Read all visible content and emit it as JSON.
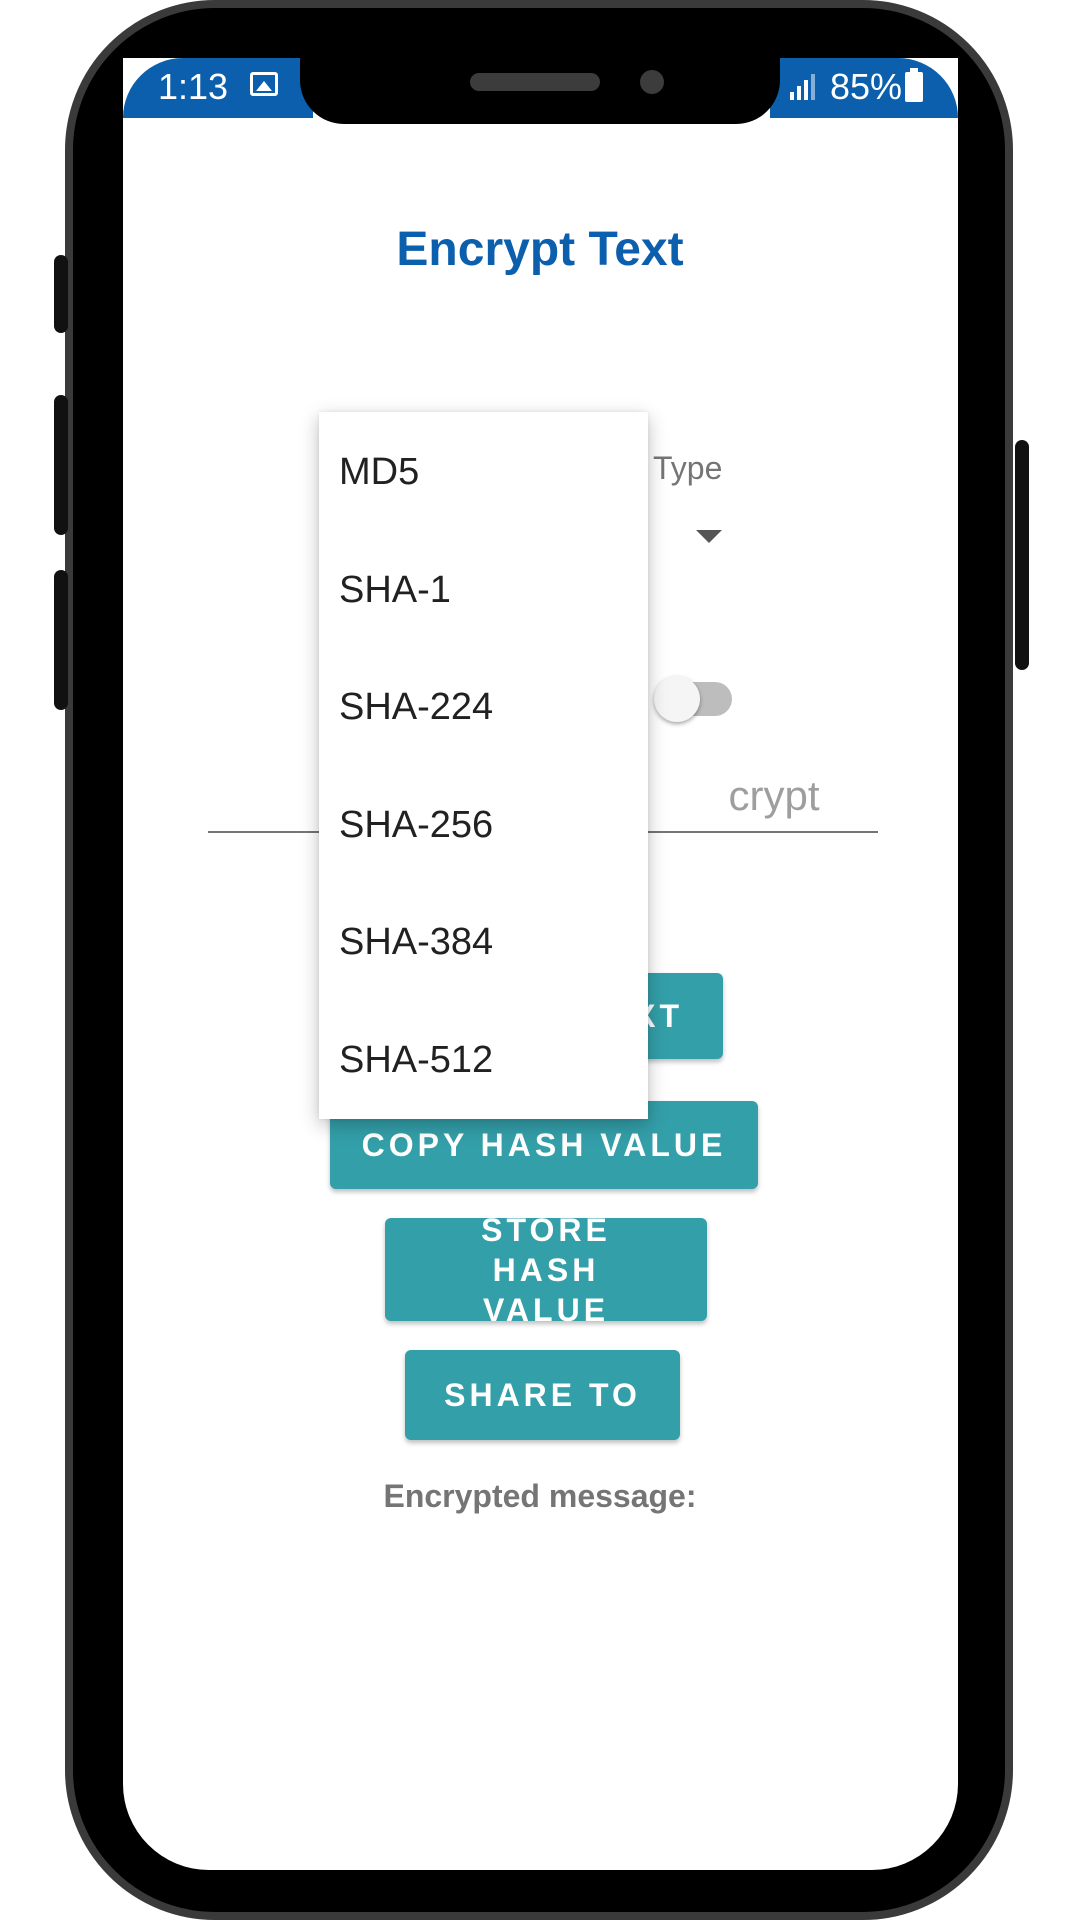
{
  "status_bar": {
    "time": "1:13",
    "battery": "85%"
  },
  "app": {
    "title": "Encrypt Text",
    "type_label": "Type",
    "input_partial_text": "crypt",
    "encrypt_button_partial": "XT",
    "copy_button": "COPY HASH VALUE",
    "store_button": "STORE HASH VALUE",
    "share_button": "SHARE TO",
    "result_label": "Encrypted message:"
  },
  "dropdown": {
    "items": [
      "MD5",
      "SHA-1",
      "SHA-224",
      "SHA-256",
      "SHA-384",
      "SHA-512"
    ]
  },
  "colors": {
    "brand_blue": "#0b5fad",
    "button_teal": "#339fa9"
  }
}
